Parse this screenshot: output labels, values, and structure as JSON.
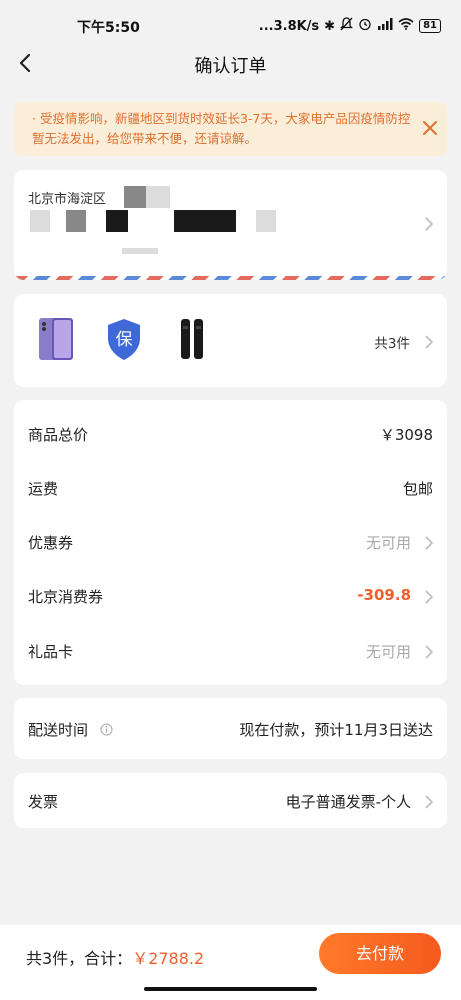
{
  "status_bar": {
    "time": "下午5:50",
    "network_speed": "...3.8K/s",
    "battery": "81",
    "icons": [
      "bluetooth-icon",
      "mute-icon",
      "alarm-icon",
      "signal-icon",
      "wifi-icon",
      "battery-icon"
    ]
  },
  "header": {
    "title": "确认订单"
  },
  "notice": {
    "text": "· 受疫情影响，新疆地区到货时效延长3-7天，大家电产品因疫情防控暂无法发出，给您带来不便，还请谅解。",
    "color": "#e07030"
  },
  "address": {
    "line1": "北京市海淀区"
  },
  "goods": {
    "items": [
      {
        "icon": "phone-product-icon"
      },
      {
        "icon": "insurance-shield-icon",
        "text": "保"
      },
      {
        "icon": "accessory-product-icon"
      }
    ],
    "count_label": "共3件"
  },
  "price": {
    "subtotal_label": "商品总价",
    "subtotal_value": "￥3098",
    "shipping_label": "运费",
    "shipping_value": "包邮",
    "coupon_label": "优惠券",
    "coupon_value": "无可用",
    "consumer_coupon_label": "北京消费券",
    "consumer_coupon_value": "-309.8",
    "gift_card_label": "礼品卡",
    "gift_card_value": "无可用"
  },
  "delivery": {
    "label": "配送时间",
    "value": "现在付款，预计11月3日送达"
  },
  "invoice": {
    "label": "发票",
    "value": "电子普通发票-个人"
  },
  "footer": {
    "total_prefix": "共3件，合计：",
    "total_amount": "￥2788.2",
    "pay_button": "去付款",
    "accent_color": "#f0602c"
  }
}
